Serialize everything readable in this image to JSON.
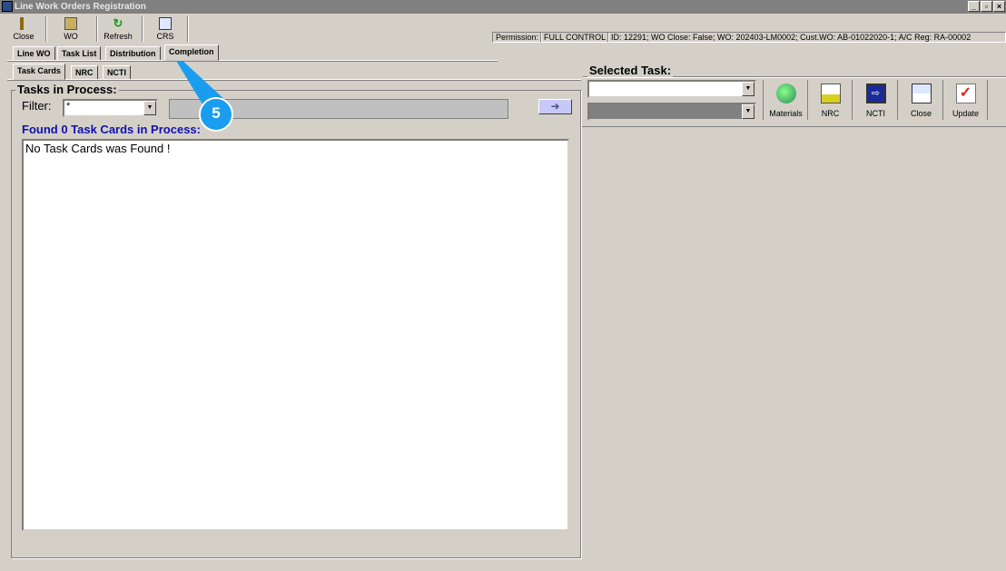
{
  "window": {
    "title": "Line Work Orders Registration",
    "min": "_",
    "max": "▫",
    "close": "×"
  },
  "toolbar": [
    {
      "label": "Close",
      "icon": "exit-door-icon"
    },
    {
      "label": "WO",
      "icon": "work-order-icon"
    },
    {
      "label": "Refresh",
      "icon": "refresh-icon"
    },
    {
      "label": "CRS",
      "icon": "crs-icon"
    }
  ],
  "status": {
    "permission_label": "Permission:",
    "permission_value": "FULL CONTROL",
    "info": "ID: 12291; WO Close: False; WO: 202403-LM0002; Cust.WO: AB-01022020-1; A/C Reg: RA-00002"
  },
  "tabs": [
    "Line WO",
    "Task List",
    "Distribution",
    "Completion"
  ],
  "subtabs": [
    "Task Cards",
    "NRC",
    "NCTI"
  ],
  "left": {
    "group_title": "Tasks in Process:",
    "filter_label": "Filter:",
    "filter_value": "*",
    "found_text": "Found 0 Task Cards in Process:",
    "list_text": "No Task Cards was Found !"
  },
  "right": {
    "group_title": "Selected Task:",
    "buttons": [
      {
        "label": "Materials"
      },
      {
        "label": "NRC"
      },
      {
        "label": "NCTI"
      },
      {
        "label": "Close"
      },
      {
        "label": "Update"
      }
    ]
  },
  "callout": {
    "number": "5",
    "color": "#1a9cf0"
  }
}
